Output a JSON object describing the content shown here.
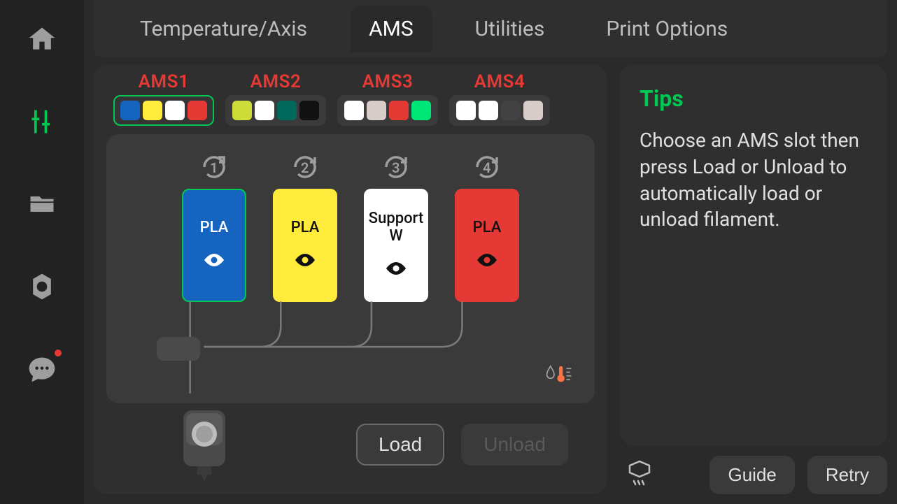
{
  "nav": {
    "items": [
      {
        "name": "home-icon"
      },
      {
        "name": "controls-icon"
      },
      {
        "name": "files-icon"
      },
      {
        "name": "settings-icon"
      },
      {
        "name": "chat-icon"
      }
    ],
    "active_index": 1,
    "chat_has_notification": true
  },
  "tabs": {
    "items": [
      "Temperature/Axis",
      "AMS",
      "Utilities",
      "Print Options"
    ],
    "active_index": 1
  },
  "ams_units": {
    "selected_index": 0,
    "items": [
      {
        "label": "AMS1",
        "colors": [
          "#1565c0",
          "#ffeb3b",
          "#ffffff",
          "#e53935"
        ]
      },
      {
        "label": "AMS2",
        "colors": [
          "#cddc39",
          "#ffffff",
          "#00695c",
          "#111111"
        ]
      },
      {
        "label": "AMS3",
        "colors": [
          "#ffffff",
          "#d7ccc8",
          "#e53935",
          "#00e676"
        ]
      },
      {
        "label": "AMS4",
        "colors": [
          "#ffffff",
          "#ffffff",
          "#424242",
          "#d7ccc8"
        ]
      }
    ]
  },
  "slots": {
    "selected_index": 0,
    "items": [
      {
        "number": "1",
        "label": "PLA",
        "bg": "#1565c0",
        "fg": "#ffffff",
        "eye": "#ffffff",
        "eye_pupil": "#1565c0"
      },
      {
        "number": "2",
        "label": "PLA",
        "bg": "#ffeb3b",
        "fg": "#111111",
        "eye": "#111111",
        "eye_pupil": "#ffeb3b"
      },
      {
        "number": "3",
        "label": "Support W",
        "bg": "#ffffff",
        "fg": "#111111",
        "eye": "#111111",
        "eye_pupil": "#ffffff"
      },
      {
        "number": "4",
        "label": "PLA",
        "bg": "#e53935",
        "fg": "#111111",
        "eye": "#111111",
        "eye_pupil": "#e53935"
      }
    ]
  },
  "buttons": {
    "load": "Load",
    "unload": "Unload",
    "unload_enabled": false
  },
  "tips": {
    "title": "Tips",
    "body": "Choose an AMS slot then press Load or Unload to automatically load or unload filament."
  },
  "footer": {
    "guide": "Guide",
    "retry": "Retry"
  }
}
